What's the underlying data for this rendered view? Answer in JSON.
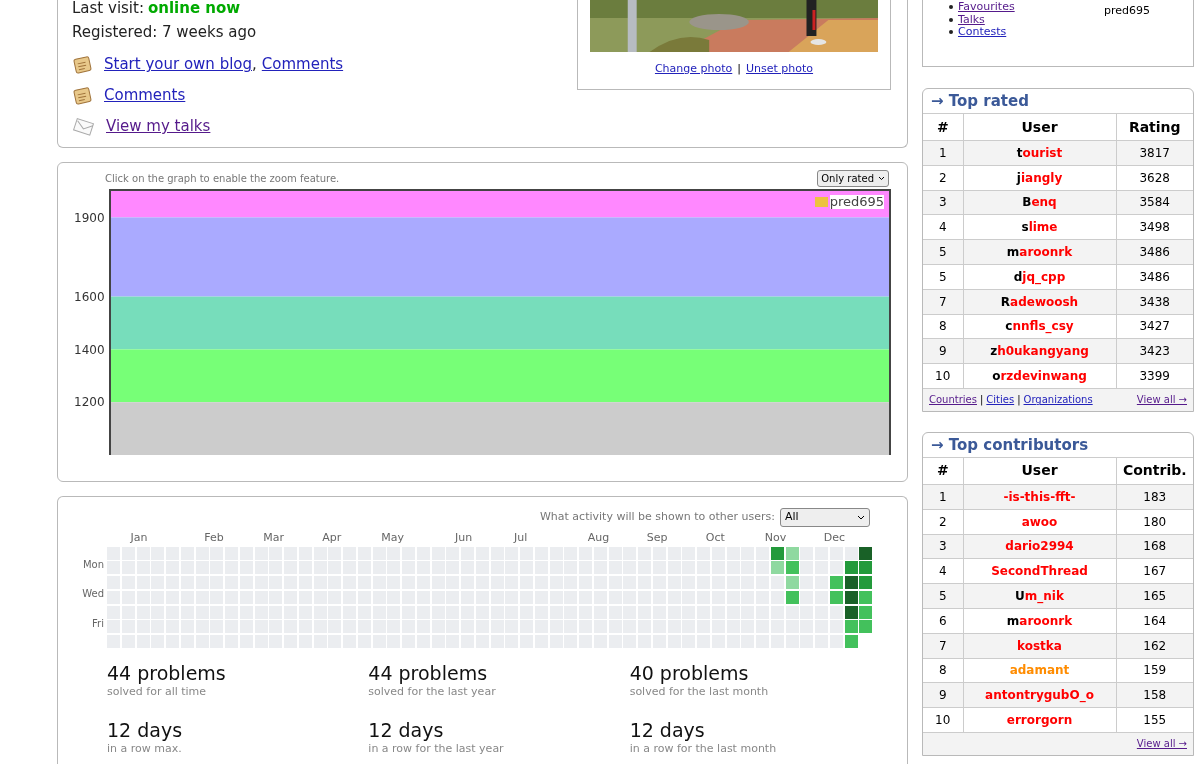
{
  "profile": {
    "last_visit_label": "Last visit:",
    "last_visit_value": "online now",
    "registered": "Registered: 7 weeks ago",
    "links": [
      {
        "kind": "blog",
        "parts": [
          {
            "text": "Start your own blog",
            "visited": false
          },
          {
            "text": "Comments",
            "visited": false
          }
        ],
        "separator": ","
      },
      {
        "kind": "blog",
        "parts": [
          {
            "text": "Comments",
            "visited": false
          }
        ]
      },
      {
        "kind": "talk",
        "parts": [
          {
            "text": "View my talks",
            "visited": true
          }
        ]
      }
    ],
    "photo": {
      "links": [
        "Change photo",
        "Unset photo"
      ],
      "separator": "|"
    }
  },
  "rating_graph": {
    "hint": "Click on the graph to enable the zoom feature.",
    "filter": "Only rated",
    "axis_labels": [
      "1900",
      "1600",
      "1400",
      "1200"
    ],
    "legend": [
      {
        "name": "pred695",
        "color": "#edc240"
      }
    ]
  },
  "activity": {
    "visibility_label": "What activity will be shown to other users:",
    "visibility_value": "All",
    "months": [
      "Jan",
      "Feb",
      "Mar",
      "Apr",
      "May",
      "Jun",
      "Jul",
      "Aug",
      "Sep",
      "Oct",
      "Nov",
      "Dec"
    ],
    "day_labels": [
      "Mon",
      "Wed",
      "Fri"
    ],
    "recent_weeks": [
      {
        "days": [
          {
            "kind": "dark"
          },
          {
            "kind": "light"
          },
          {
            "kind": "none"
          },
          {
            "kind": "none"
          },
          {
            "kind": "none"
          },
          {
            "kind": "none"
          },
          {
            "kind": "none"
          }
        ]
      },
      {
        "days": [
          {
            "kind": "light"
          },
          {
            "kind": "medium"
          },
          {
            "kind": "light"
          },
          {
            "kind": "medium"
          },
          {
            "kind": "none"
          },
          {
            "kind": "none"
          },
          {
            "kind": "none"
          }
        ]
      },
      {
        "days": [
          {
            "kind": "none"
          },
          {
            "kind": "none"
          },
          {
            "kind": "none"
          },
          {
            "kind": "none"
          },
          {
            "kind": "none"
          },
          {
            "kind": "none"
          },
          {
            "kind": "none"
          }
        ]
      },
      {
        "days": [
          {
            "kind": "none"
          },
          {
            "kind": "none"
          },
          {
            "kind": "none"
          },
          {
            "kind": "none"
          },
          {
            "kind": "none"
          },
          {
            "kind": "none"
          },
          {
            "kind": "none"
          }
        ]
      },
      {
        "days": [
          {
            "kind": "none"
          },
          {
            "kind": "none"
          },
          {
            "kind": "medium"
          },
          {
            "kind": "medium"
          },
          {
            "kind": "none"
          },
          {
            "kind": "none"
          },
          {
            "kind": "none"
          }
        ]
      },
      {
        "days": [
          {
            "kind": "none"
          },
          {
            "kind": "dark"
          },
          {
            "kind": "darkest"
          },
          {
            "kind": "darkest"
          },
          {
            "kind": "darkest"
          },
          {
            "kind": "medium"
          },
          {
            "kind": "medium"
          }
        ]
      },
      {
        "days": [
          {
            "kind": "darkest"
          },
          {
            "kind": "dark"
          },
          {
            "kind": "dark"
          },
          {
            "kind": "medium"
          },
          {
            "kind": "medium"
          },
          {
            "kind": "medium"
          }
        ]
      }
    ],
    "stats": [
      {
        "value": "44 problems",
        "caption": "solved for all time"
      },
      {
        "value": "44 problems",
        "caption": "solved for the last year"
      },
      {
        "value": "40 problems",
        "caption": "solved for the last month"
      },
      {
        "value": "12 days",
        "caption": "in a row max."
      },
      {
        "value": "12 days",
        "caption": "in a row for the last year"
      },
      {
        "value": "12 days",
        "caption": "in a row for the last month"
      }
    ]
  },
  "sidebar": {
    "menu": [
      {
        "text": "Favourites",
        "visited": true
      },
      {
        "text": "Talks",
        "visited": true
      },
      {
        "text": "Contests",
        "visited": false
      }
    ],
    "handle": "pred695",
    "top_rated": {
      "title": "→ Top rated",
      "columns": [
        "#",
        "User",
        "Rating"
      ],
      "rows": [
        {
          "rank": "1",
          "user": "tourist",
          "kind": "legendary",
          "value": "3817"
        },
        {
          "rank": "2",
          "user": "jiangly",
          "kind": "legendary",
          "value": "3628"
        },
        {
          "rank": "3",
          "user": "Benq",
          "kind": "legendary",
          "value": "3584"
        },
        {
          "rank": "4",
          "user": "slime",
          "kind": "legendary",
          "value": "3498"
        },
        {
          "rank": "5",
          "user": "maroonrk",
          "kind": "legendary",
          "value": "3486"
        },
        {
          "rank": "5",
          "user": "djq_cpp",
          "kind": "legendary",
          "value": "3486"
        },
        {
          "rank": "7",
          "user": "Radewoosh",
          "kind": "legendary",
          "value": "3438"
        },
        {
          "rank": "8",
          "user": "cnnfls_csy",
          "kind": "legendary",
          "value": "3427"
        },
        {
          "rank": "9",
          "user": "zh0ukangyang",
          "kind": "legendary",
          "value": "3423"
        },
        {
          "rank": "10",
          "user": "orzdevinwang",
          "kind": "legendary",
          "value": "3399"
        }
      ],
      "footer_links": [
        {
          "text": "Countries",
          "visited": true
        },
        {
          "text": "Cities",
          "visited": false
        },
        {
          "text": "Organizations",
          "visited": false
        }
      ],
      "footer_separators": [
        "|",
        "|"
      ],
      "view_all": "View all →"
    },
    "top_contributors": {
      "title": "→ Top contributors",
      "columns": [
        "#",
        "User",
        "Contrib."
      ],
      "rows": [
        {
          "rank": "1",
          "user": "-is-this-fft-",
          "kind": "red",
          "value": "183"
        },
        {
          "rank": "2",
          "user": "awoo",
          "kind": "red",
          "value": "180"
        },
        {
          "rank": "3",
          "user": "dario2994",
          "kind": "red",
          "value": "168"
        },
        {
          "rank": "4",
          "user": "SecondThread",
          "kind": "red",
          "value": "167"
        },
        {
          "rank": "5",
          "user": "Um_nik",
          "kind": "legendary",
          "value": "165"
        },
        {
          "rank": "6",
          "user": "maroonrk",
          "kind": "legendary",
          "value": "164"
        },
        {
          "rank": "7",
          "user": "kostka",
          "kind": "red",
          "value": "162"
        },
        {
          "rank": "8",
          "user": "adamant",
          "kind": "orange",
          "value": "159"
        },
        {
          "rank": "9",
          "user": "antontrygubO_o",
          "kind": "red",
          "value": "158"
        },
        {
          "rank": "10",
          "user": "errorgorn",
          "kind": "red",
          "value": "155"
        }
      ],
      "view_all": "View all →"
    }
  }
}
